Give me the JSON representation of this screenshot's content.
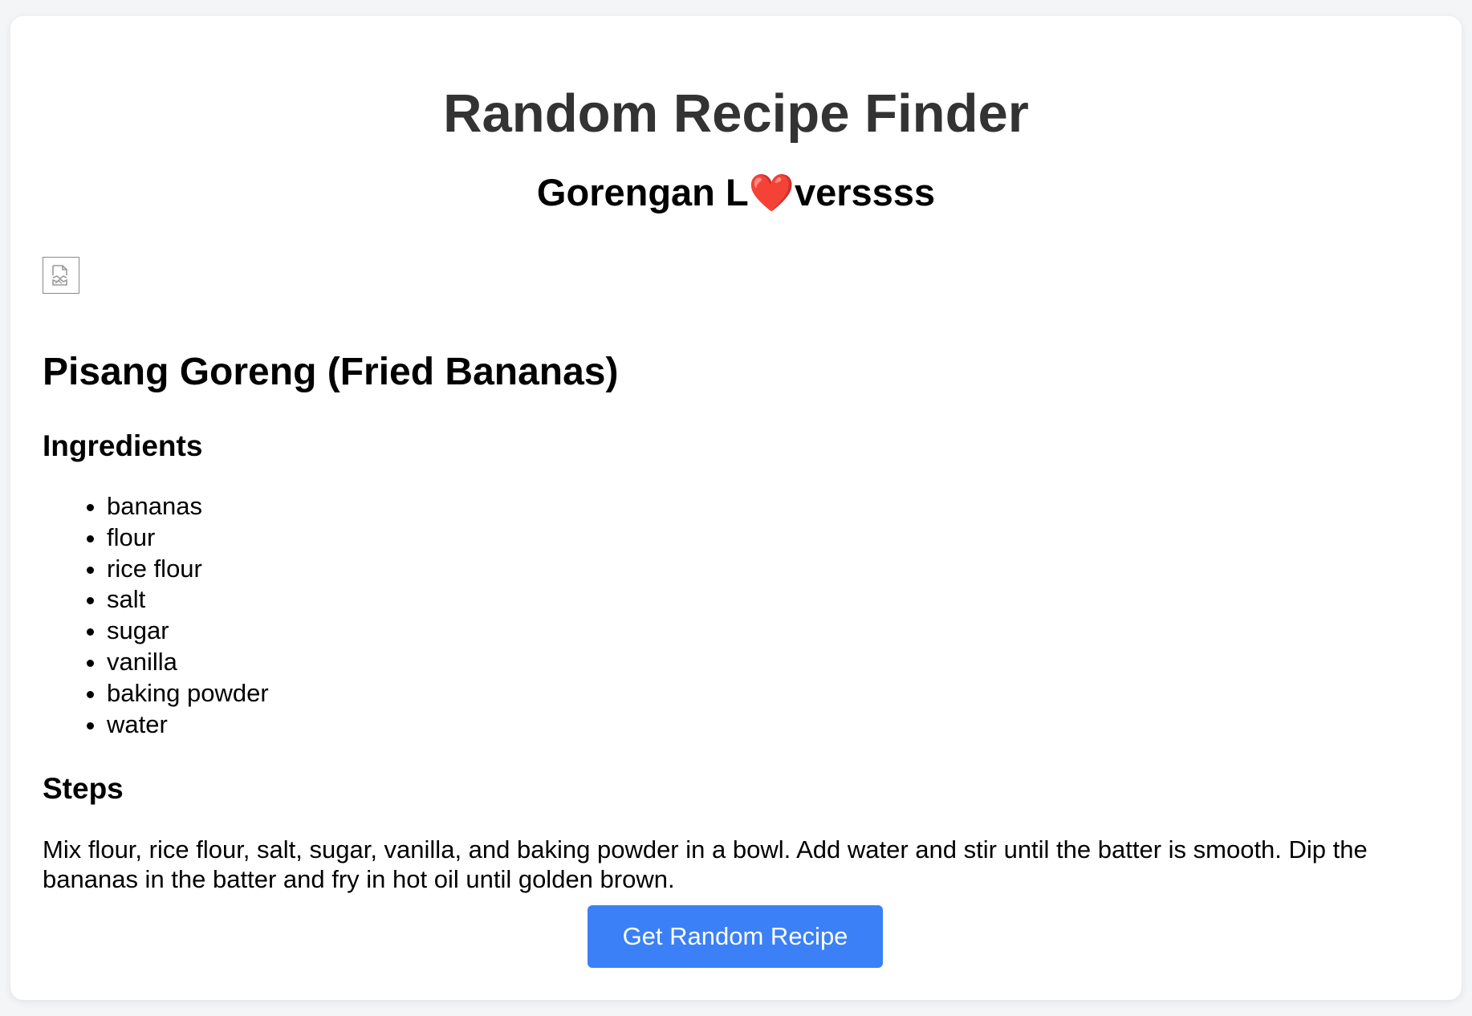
{
  "app": {
    "title": "Random Recipe Finder",
    "subtitle_before": "Gorengan L",
    "subtitle_heart": "❤️",
    "subtitle_after": "verssss"
  },
  "recipe": {
    "image_icon": "broken-image-icon",
    "name": "Pisang Goreng (Fried Bananas)",
    "ingredients_heading": "Ingredients",
    "ingredients": [
      "bananas",
      "flour",
      "rice flour",
      "salt",
      "sugar",
      "vanilla",
      "baking powder",
      "water"
    ],
    "steps_heading": "Steps",
    "steps": "Mix flour, rice flour, salt, sugar, vanilla, and baking powder in a bowl. Add water and stir until the batter is smooth. Dip the bananas in the batter and fry in hot oil until golden brown."
  },
  "actions": {
    "random_button_label": "Get Random Recipe"
  },
  "colors": {
    "background": "#f4f5f7",
    "card": "#ffffff",
    "title": "#333333",
    "button": "#3b80f7",
    "heart": "#e0262b"
  }
}
